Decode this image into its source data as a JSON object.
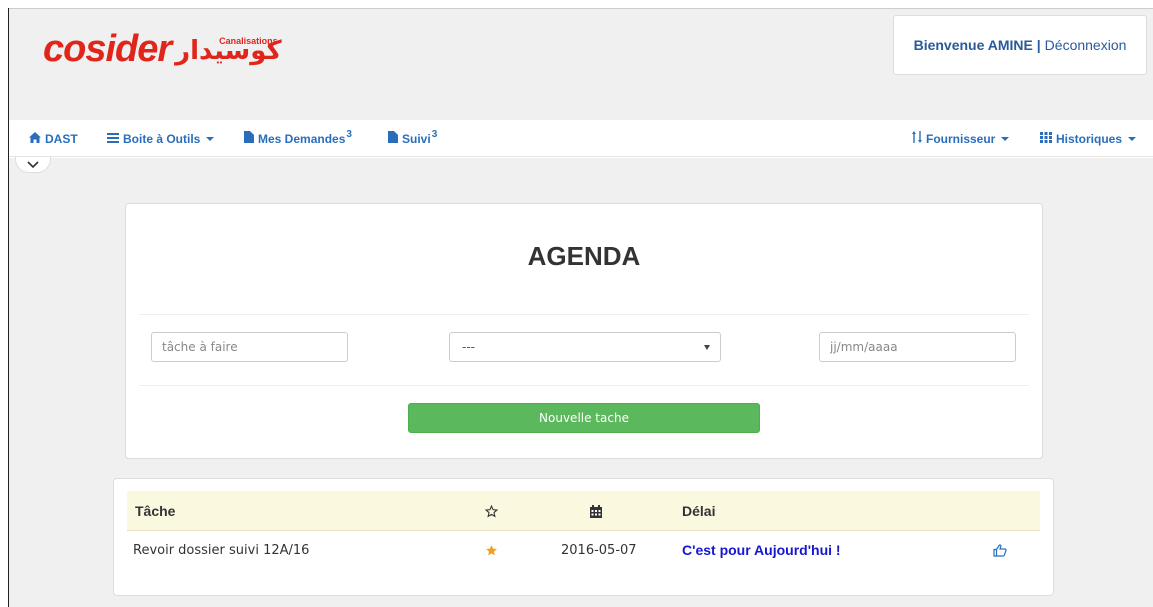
{
  "header": {
    "logo_text": "cosider",
    "logo_arabic": "كوسيدار",
    "logo_subtitle": "Canalisations",
    "welcome": "Bienvenue AMINE |",
    "logout": "Déconnexion"
  },
  "nav": {
    "home": "DAST",
    "tools": "Boite à Outils",
    "requests": "Mes Demandes",
    "requests_count": "3",
    "followup": "Suivi",
    "followup_count": "3",
    "supplier": "Fournisseur",
    "history": "Historiques"
  },
  "agenda": {
    "title": "AGENDA",
    "task_placeholder": "tâche à faire",
    "select_value": "---",
    "date_placeholder": "jj/mm/aaaa",
    "new_task_label": "Nouvelle tache"
  },
  "tasks": {
    "headers": {
      "task": "Tâche",
      "delay": "Délai"
    },
    "rows": [
      {
        "task": "Revoir dossier suivi 12A/16",
        "date": "2016-05-07",
        "delay": "C'est pour Aujourd'hui !"
      }
    ]
  },
  "colors": {
    "brand": "#e0251b",
    "nav_link": "#2a6ebb",
    "success": "#5cb85c",
    "star": "#f0a020",
    "delay": "#1515d4"
  },
  "icons": {
    "home": "home-icon",
    "tools": "menu-icon",
    "requests": "file-icon",
    "followup": "file-icon",
    "supplier": "sort-icon",
    "history": "grid-icon",
    "star_header": "star-outline-icon",
    "date_header": "calendar-icon",
    "row_star": "star-filled-icon",
    "row_action": "thumbs-up-icon",
    "toggle": "chevron-down-icon"
  }
}
